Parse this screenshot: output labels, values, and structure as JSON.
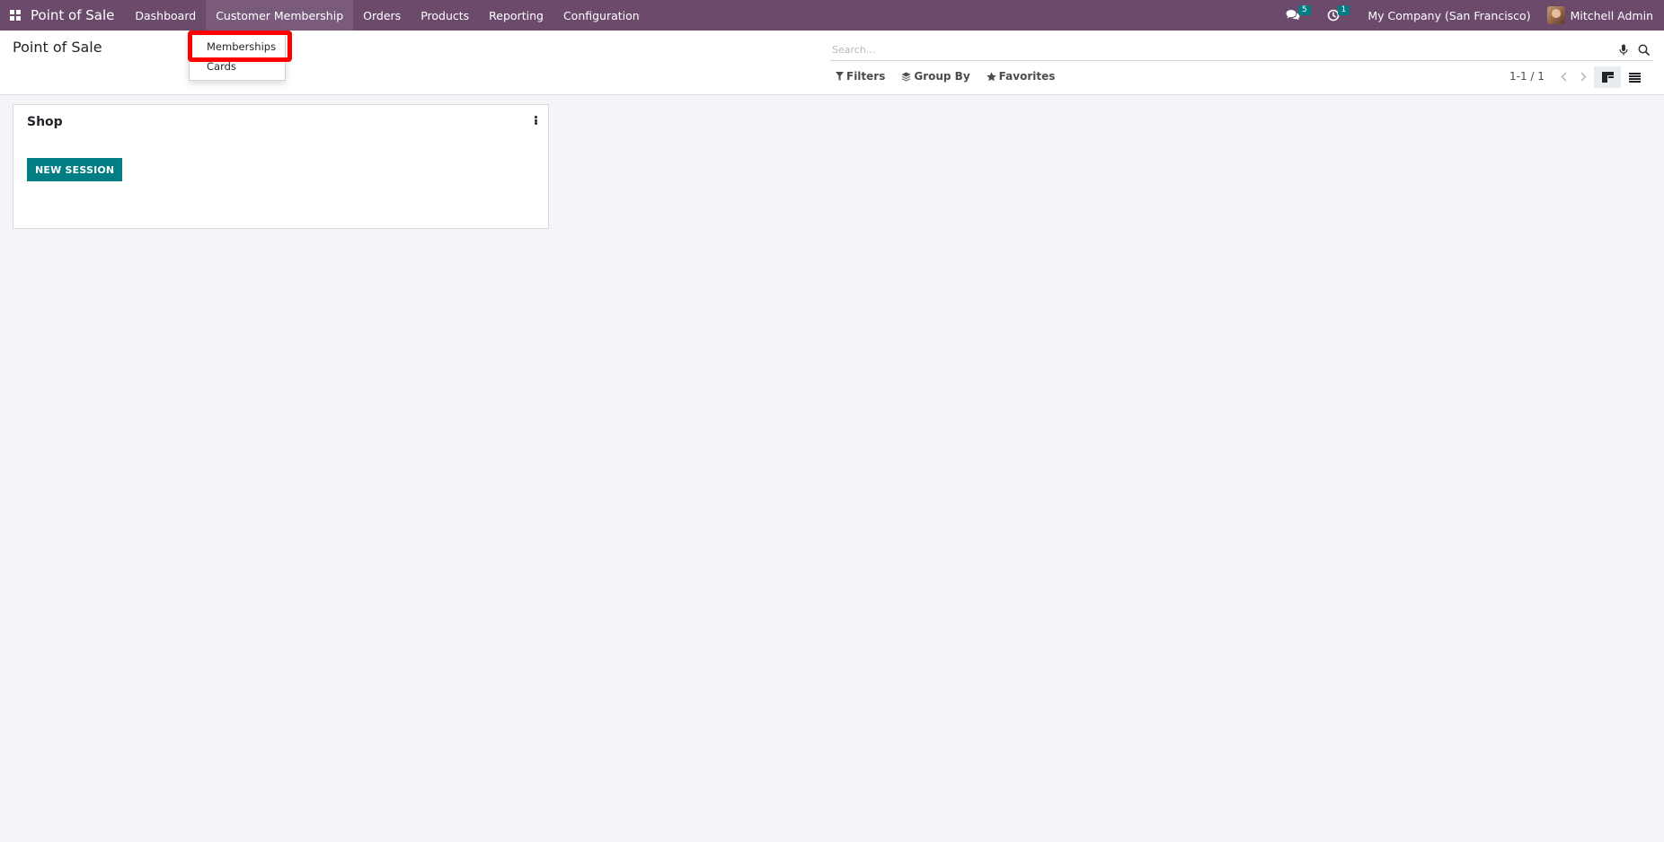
{
  "navbar": {
    "app_name": "Point of Sale",
    "menu": [
      {
        "label": "Dashboard"
      },
      {
        "label": "Customer Membership"
      },
      {
        "label": "Orders"
      },
      {
        "label": "Products"
      },
      {
        "label": "Reporting"
      },
      {
        "label": "Configuration"
      }
    ],
    "messages_count": "5",
    "activities_count": "1",
    "company": "My Company (San Francisco)",
    "user": "Mitchell Admin",
    "color": "#6b4a6c"
  },
  "dropdown": {
    "items": [
      {
        "label": "Memberships"
      },
      {
        "label": "Cards"
      }
    ],
    "highlight_color": "#ff0000"
  },
  "control_panel": {
    "title": "Point of Sale",
    "search_placeholder": "Search...",
    "filters_label": "Filters",
    "group_by_label": "Group By",
    "favorites_label": "Favorites",
    "pager": "1-1 / 1"
  },
  "kanban": {
    "cards": [
      {
        "name": "Shop",
        "button_label": "NEW SESSION"
      }
    ],
    "accent": "#017e84"
  }
}
